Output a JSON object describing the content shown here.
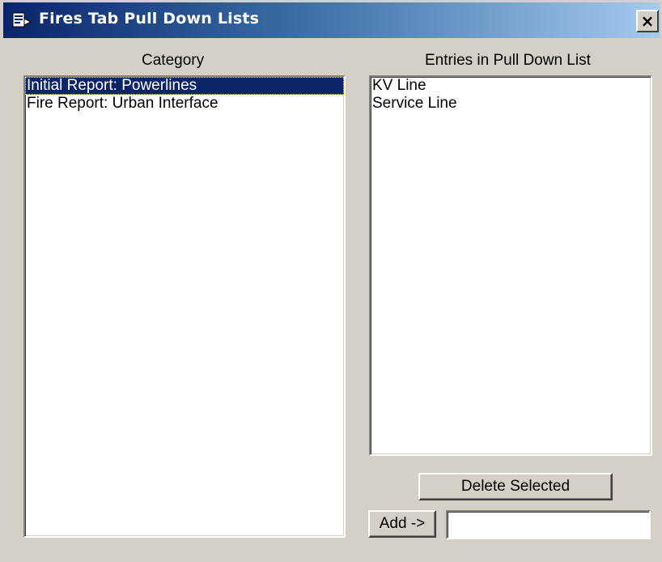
{
  "window": {
    "title": "Fires Tab Pull Down Lists",
    "close_label": "×"
  },
  "category": {
    "label": "Category",
    "items": [
      {
        "label": "Initial Report: Powerlines",
        "selected": true
      },
      {
        "label": "Fire Report: Urban Interface",
        "selected": false
      }
    ]
  },
  "entries": {
    "label": "Entries in Pull Down List",
    "items": [
      {
        "label": "KV Line"
      },
      {
        "label": "Service Line"
      }
    ]
  },
  "actions": {
    "delete_label": "Delete Selected",
    "add_label": "Add ->",
    "add_input_value": "",
    "add_input_placeholder": ""
  },
  "colors": {
    "selection": "#0a246a",
    "face": "#d4d0c8"
  }
}
